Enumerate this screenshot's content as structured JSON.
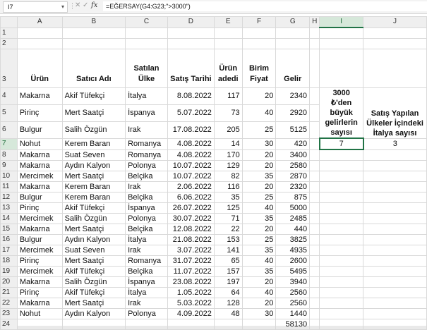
{
  "formula_bar": {
    "name_box": "I7",
    "formula": "=EĞERSAY(G4:G23;\">3000\")"
  },
  "columns": [
    "A",
    "B",
    "C",
    "D",
    "E",
    "F",
    "G",
    "H",
    "I",
    "J"
  ],
  "headers": {
    "urun": "Ürün",
    "satici": "Satıcı Adı",
    "ulke": "Satılan Ülke",
    "tarih": "Satış Tarihi",
    "adet": "Ürün adedi",
    "fiyat": "Birim Fiyat",
    "gelir": "Gelir"
  },
  "rows": [
    {
      "urun": "Makarna",
      "satici": "Akif Tüfekçi",
      "ulke": "İtalya",
      "tarih": "8.08.2022",
      "adet": "117",
      "fiyat": "20",
      "gelir": "2340"
    },
    {
      "urun": "Pirinç",
      "satici": "Mert Saatçi",
      "ulke": "İspanya",
      "tarih": "5.07.2022",
      "adet": "73",
      "fiyat": "40",
      "gelir": "2920"
    },
    {
      "urun": "Bulgur",
      "satici": "Salih Özgün",
      "ulke": "Irak",
      "tarih": "17.08.2022",
      "adet": "205",
      "fiyat": "25",
      "gelir": "5125"
    },
    {
      "urun": "Nohut",
      "satici": "Kerem Baran",
      "ulke": "Romanya",
      "tarih": "4.08.2022",
      "adet": "14",
      "fiyat": "30",
      "gelir": "420"
    },
    {
      "urun": "Makarna",
      "satici": "Suat Seven",
      "ulke": "Romanya",
      "tarih": "4.08.2022",
      "adet": "170",
      "fiyat": "20",
      "gelir": "3400"
    },
    {
      "urun": "Makarna",
      "satici": "Aydın Kalyon",
      "ulke": "Polonya",
      "tarih": "10.07.2022",
      "adet": "129",
      "fiyat": "20",
      "gelir": "2580"
    },
    {
      "urun": "Mercimek",
      "satici": "Mert Saatçi",
      "ulke": "Belçika",
      "tarih": "10.07.2022",
      "adet": "82",
      "fiyat": "35",
      "gelir": "2870"
    },
    {
      "urun": "Makarna",
      "satici": "Kerem Baran",
      "ulke": "Irak",
      "tarih": "2.06.2022",
      "adet": "116",
      "fiyat": "20",
      "gelir": "2320"
    },
    {
      "urun": "Bulgur",
      "satici": "Kerem Baran",
      "ulke": "Belçika",
      "tarih": "6.06.2022",
      "adet": "35",
      "fiyat": "25",
      "gelir": "875"
    },
    {
      "urun": "Pirinç",
      "satici": "Akif Tüfekçi",
      "ulke": "İspanya",
      "tarih": "26.07.2022",
      "adet": "125",
      "fiyat": "40",
      "gelir": "5000"
    },
    {
      "urun": "Mercimek",
      "satici": "Salih Özgün",
      "ulke": "Polonya",
      "tarih": "30.07.2022",
      "adet": "71",
      "fiyat": "35",
      "gelir": "2485"
    },
    {
      "urun": "Makarna",
      "satici": "Mert Saatçi",
      "ulke": "Belçika",
      "tarih": "12.08.2022",
      "adet": "22",
      "fiyat": "20",
      "gelir": "440"
    },
    {
      "urun": "Bulgur",
      "satici": "Aydın Kalyon",
      "ulke": "İtalya",
      "tarih": "21.08.2022",
      "adet": "153",
      "fiyat": "25",
      "gelir": "3825"
    },
    {
      "urun": "Mercimek",
      "satici": "Suat Seven",
      "ulke": "Irak",
      "tarih": "3.07.2022",
      "adet": "141",
      "fiyat": "35",
      "gelir": "4935"
    },
    {
      "urun": "Pirinç",
      "satici": "Mert Saatçi",
      "ulke": "Romanya",
      "tarih": "31.07.2022",
      "adet": "65",
      "fiyat": "40",
      "gelir": "2600"
    },
    {
      "urun": "Mercimek",
      "satici": "Akif Tüfekçi",
      "ulke": "Belçika",
      "tarih": "11.07.2022",
      "adet": "157",
      "fiyat": "35",
      "gelir": "5495"
    },
    {
      "urun": "Makarna",
      "satici": "Salih Özgün",
      "ulke": "İspanya",
      "tarih": "23.08.2022",
      "adet": "197",
      "fiyat": "20",
      "gelir": "3940"
    },
    {
      "urun": "Pirinç",
      "satici": "Akif Tüfekçi",
      "ulke": "İtalya",
      "tarih": "1.05.2022",
      "adet": "64",
      "fiyat": "40",
      "gelir": "2560"
    },
    {
      "urun": "Makarna",
      "satici": "Mert Saatçi",
      "ulke": "Irak",
      "tarih": "5.03.2022",
      "adet": "128",
      "fiyat": "20",
      "gelir": "2560"
    },
    {
      "urun": "Nohut",
      "satici": "Aydın Kalyon",
      "ulke": "Polonya",
      "tarih": "4.09.2022",
      "adet": "48",
      "fiyat": "30",
      "gelir": "1440"
    }
  ],
  "total_gelir": "58130",
  "summary": {
    "label_over3000": "3000 ₺'den büyük gelirlerin sayısı",
    "value_over3000": "7",
    "label_italy": "Satış Yapılan Ülkeler İçindeki İtalya sayısı",
    "value_italy": "3"
  },
  "accent_color": "#217346"
}
